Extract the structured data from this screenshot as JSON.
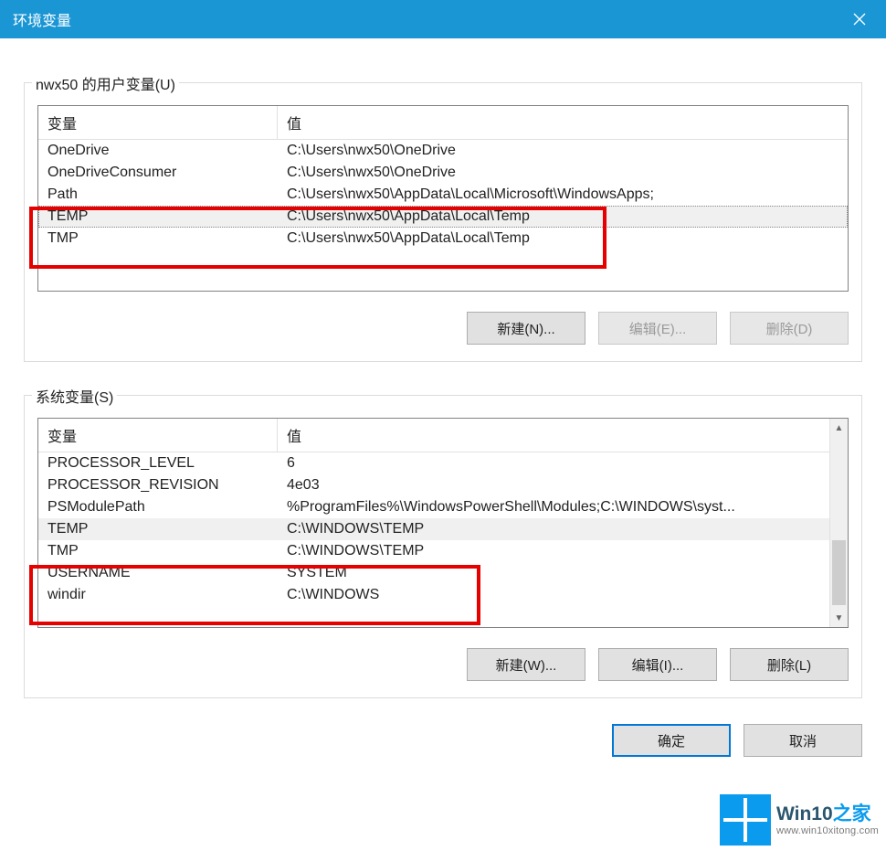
{
  "title": "环境变量",
  "user_section": {
    "legend": "nwx50 的用户变量(U)",
    "columns": {
      "variable": "变量",
      "value": "值"
    },
    "rows": [
      {
        "name": "OneDrive",
        "value": "C:\\Users\\nwx50\\OneDrive"
      },
      {
        "name": "OneDriveConsumer",
        "value": "C:\\Users\\nwx50\\OneDrive"
      },
      {
        "name": "Path",
        "value": "C:\\Users\\nwx50\\AppData\\Local\\Microsoft\\WindowsApps;"
      },
      {
        "name": "TEMP",
        "value": "C:\\Users\\nwx50\\AppData\\Local\\Temp"
      },
      {
        "name": "TMP",
        "value": "C:\\Users\\nwx50\\AppData\\Local\\Temp"
      }
    ],
    "buttons": {
      "new": "新建(N)...",
      "edit": "编辑(E)...",
      "delete": "删除(D)"
    }
  },
  "system_section": {
    "legend": "系统变量(S)",
    "columns": {
      "variable": "变量",
      "value": "值"
    },
    "rows": [
      {
        "name": "PROCESSOR_LEVEL",
        "value": "6"
      },
      {
        "name": "PROCESSOR_REVISION",
        "value": "4e03"
      },
      {
        "name": "PSModulePath",
        "value": "%ProgramFiles%\\WindowsPowerShell\\Modules;C:\\WINDOWS\\syst..."
      },
      {
        "name": "TEMP",
        "value": "C:\\WINDOWS\\TEMP"
      },
      {
        "name": "TMP",
        "value": "C:\\WINDOWS\\TEMP"
      },
      {
        "name": "USERNAME",
        "value": "SYSTEM"
      },
      {
        "name": "windir",
        "value": "C:\\WINDOWS"
      }
    ],
    "buttons": {
      "new": "新建(W)...",
      "edit": "编辑(I)...",
      "delete": "删除(L)"
    }
  },
  "dialog_buttons": {
    "ok": "确定",
    "cancel": "取消"
  },
  "watermark": {
    "brand_pre": "Win10",
    "brand_post": "之家",
    "url": "www.win10xitong.com"
  }
}
